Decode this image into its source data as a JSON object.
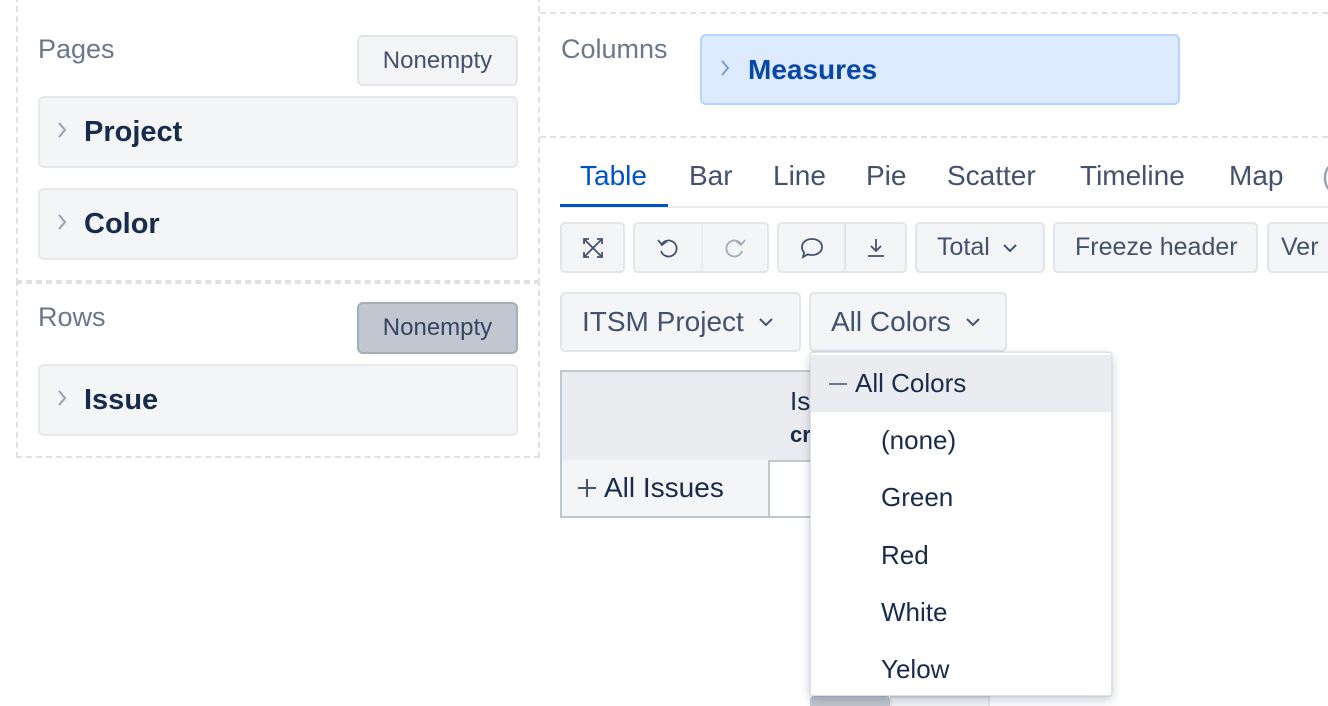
{
  "pages": {
    "title": "Pages",
    "nonempty_label": "Nonempty",
    "dimensions": [
      "Project",
      "Color"
    ]
  },
  "rows": {
    "title": "Rows",
    "nonempty_label": "Nonempty",
    "dimensions": [
      "Issue"
    ]
  },
  "columns": {
    "title": "Columns",
    "dimensions": [
      "Measures"
    ]
  },
  "view_tabs": {
    "items": [
      "Table",
      "Bar",
      "Line",
      "Pie",
      "Scatter",
      "Timeline",
      "Map"
    ],
    "active": "Table"
  },
  "toolbar": {
    "total_label": "Total",
    "freeze_header_label": "Freeze header",
    "vertical_label": "Ver"
  },
  "filters": {
    "project_value": "ITSM Project",
    "color_value": "All Colors"
  },
  "table": {
    "column_header_partial": "Is",
    "column_header_partial_2": "cr",
    "row_header": "All Issues"
  },
  "color_dropdown": {
    "selected": "All Colors",
    "options": [
      "(none)",
      "Green",
      "Red",
      "White",
      "Yelow"
    ]
  },
  "colors": {
    "accent": "#0052cc",
    "chip_bg": "#f4f5f7",
    "measures_bg": "#deebff",
    "active_nonempty": "#c1c7d0"
  }
}
